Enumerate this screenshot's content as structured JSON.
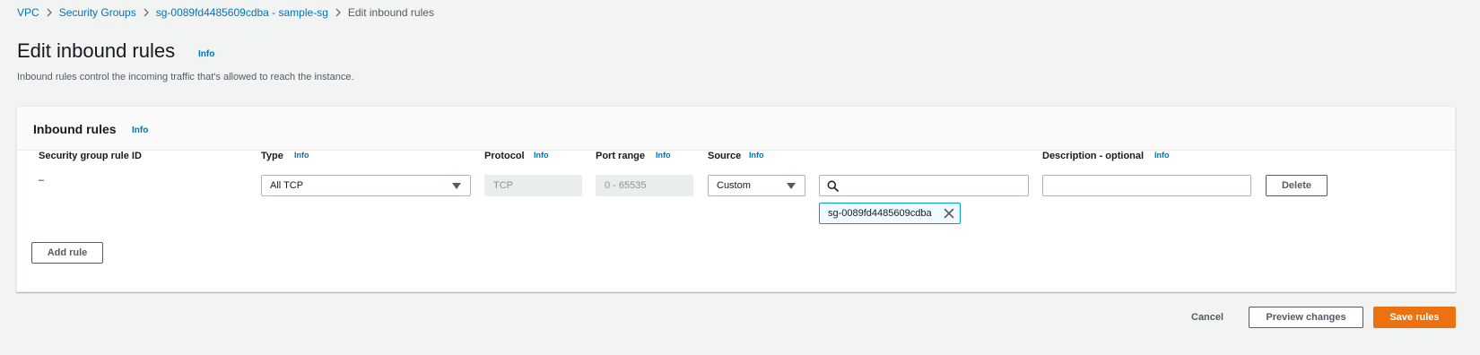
{
  "breadcrumb": {
    "items": [
      "VPC",
      "Security Groups",
      "sg-0089fd4485609cdba - sample-sg",
      "Edit inbound rules"
    ]
  },
  "page": {
    "title": "Edit inbound rules",
    "info": "Info",
    "description": "Inbound rules control the incoming traffic that's allowed to reach the instance."
  },
  "panel": {
    "title": "Inbound rules",
    "info": "Info",
    "columns": {
      "rule_id": "Security group rule ID",
      "type": "Type",
      "protocol": "Protocol",
      "port_range": "Port range",
      "source": "Source",
      "description": "Description - optional"
    },
    "info_label": "Info",
    "row": {
      "rule_id": "–",
      "type": "All TCP",
      "protocol": "TCP",
      "port_range": "0 - 65535",
      "source": "Custom",
      "source_search": "",
      "source_token": "sg-0089fd4485609cdba",
      "description": "",
      "delete": "Delete"
    },
    "add_rule": "Add rule"
  },
  "footer": {
    "cancel": "Cancel",
    "preview": "Preview changes",
    "save": "Save rules"
  },
  "colors": {
    "link": "#0073bb",
    "primary": "#ec7211",
    "token_border": "#00a1c9"
  }
}
